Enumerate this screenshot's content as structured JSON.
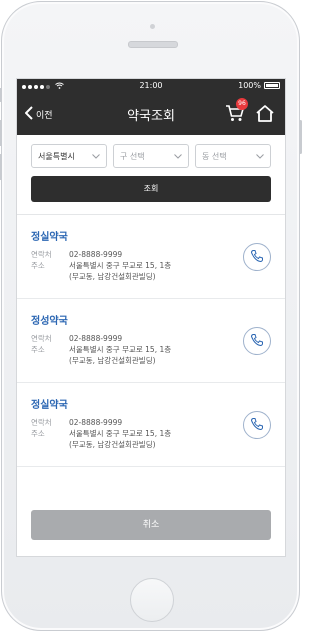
{
  "status_bar": {
    "time": "21:00",
    "battery": "100%"
  },
  "header": {
    "back_label": "이전",
    "title": "약국조회",
    "cart_badge": "96"
  },
  "filters": {
    "city": "서울특별시",
    "district_placeholder": "구 선택",
    "dong_placeholder": "동 선택",
    "search_label": "조회"
  },
  "results": [
    {
      "name": "정실약국",
      "phone_label": "연락처",
      "phone": "02-8888-9999",
      "address_label": "주소",
      "address_line1": "서울특별시 중구 무교로 15, 1층",
      "address_line2": "(무교동, 남강건설회관빌딩)"
    },
    {
      "name": "정성약국",
      "phone_label": "연락처",
      "phone": "02-8888-9999",
      "address_label": "주소",
      "address_line1": "서울특별시 중구 무교로 15, 1층",
      "address_line2": "(무교동, 남강건설회관빌딩)"
    },
    {
      "name": "정실약국",
      "phone_label": "연락처",
      "phone": "02-8888-9999",
      "address_label": "주소",
      "address_line1": "서울특별시 중구 무교로 15, 1층",
      "address_line2": "(무교동, 남강건설회관빌딩)"
    }
  ],
  "footer": {
    "cancel_label": "취소"
  },
  "colors": {
    "header_bg": "#2e2e2e",
    "name_blue": "#2c67b3",
    "badge_red": "#e8393c",
    "cancel_gray": "#a9abae"
  },
  "icons": [
    "back-chevron-icon",
    "cart-icon",
    "home-icon",
    "chevron-down-icon",
    "phone-icon",
    "wifi-icon",
    "battery-icon"
  ]
}
